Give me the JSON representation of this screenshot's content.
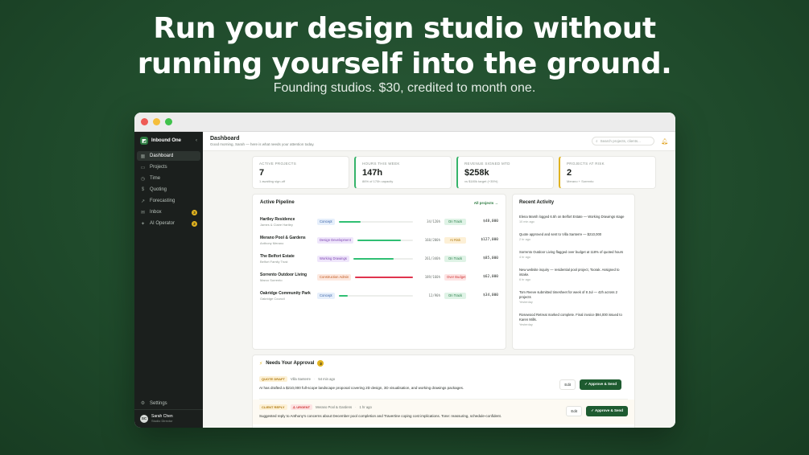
{
  "hero": {
    "line1": "Run your design studio without",
    "line2": "running yourself into the ground.",
    "sub": "Founding studios. $30, credited to month one."
  },
  "sidebar": {
    "brand": "Inbound One",
    "items": [
      {
        "label": "Dashboard",
        "icon": "grid-icon"
      },
      {
        "label": "Projects",
        "icon": "folder-icon"
      },
      {
        "label": "Time",
        "icon": "clock-icon"
      },
      {
        "label": "Quoting",
        "icon": "dollar-icon"
      },
      {
        "label": "Forecasting",
        "icon": "trend-icon"
      },
      {
        "label": "Inbox",
        "icon": "inbox-icon",
        "badge": "3"
      },
      {
        "label": "AI Operator",
        "icon": "sparkle-icon",
        "badge": "2"
      }
    ],
    "settings": "Settings",
    "user": {
      "initials": "SC",
      "name": "Sarah Chen",
      "role": "Studio Director"
    }
  },
  "topbar": {
    "title": "Dashboard",
    "subtitle": "Good morning, Sarah — here is what needs your attention today.",
    "search_placeholder": "Search projects, clients..."
  },
  "stats": [
    {
      "label": "ACTIVE PROJECTS",
      "value": "7",
      "note": "1 awaiting sign-off"
    },
    {
      "label": "HOURS THIS WEEK",
      "value": "147h",
      "note": "86% of 170h capacity"
    },
    {
      "label": "REVENUE SIGNED MTD",
      "value": "$258k",
      "note": "vs $180k target (+35%)"
    },
    {
      "label": "PROJECTS AT RISK",
      "value": "2",
      "note": "Merano + Sorrento"
    }
  ],
  "pipeline": {
    "title": "Active Pipeline",
    "link": "All projects →",
    "rows": [
      {
        "name": "Hartley Residence",
        "client": "James & Claire Hartley",
        "stage": "Concept",
        "progress": 0.3,
        "hours": "34/120h",
        "status": "On Track",
        "value": "$48,000"
      },
      {
        "name": "Merano Pool & Gardens",
        "client": "Anthony Merano",
        "stage": "Design Development",
        "progress": 0.78,
        "hours": "168/200h",
        "status": "At Risk",
        "value": "$127,000"
      },
      {
        "name": "The Belfort Estate",
        "client": "Belfort Family Trust",
        "stage": "Working Drawings",
        "progress": 0.68,
        "hours": "261/340h",
        "status": "On Track",
        "value": "$85,000"
      },
      {
        "name": "Sorrento Outdoor Living",
        "client": "Marco Sorrento",
        "stage": "Construction Admin",
        "progress": 1.0,
        "hours": "189/160h",
        "status": "Over Budget",
        "value": "$62,000"
      },
      {
        "name": "Oakridge Community Park",
        "client": "Oakridge Council",
        "stage": "Concept",
        "progress": 0.12,
        "hours": "12/90h",
        "status": "On Track",
        "value": "$34,000"
      }
    ]
  },
  "activity": {
    "title": "Recent Activity",
    "items": [
      {
        "text": "Elena Marsh logged 6.5h on Belfort Estate — Working Drawings stage",
        "when": "10 min ago"
      },
      {
        "text": "Quote approved and sent to Villa Santerre — $210,000",
        "when": "2 hr ago"
      },
      {
        "text": "Sorrento Outdoor Living flagged over budget at 118% of quoted hours",
        "when": "4 hr ago"
      },
      {
        "text": "New website inquiry — residential pool project, Toorak. Assigned to intake.",
        "when": "6 hr ago"
      },
      {
        "text": "Tom Reeve submitted timesheet for week of 8 Jul — 42h across 2 projects",
        "when": "Yesterday"
      },
      {
        "text": "Rosewood Retreat marked complete. Final invoice $94,000 issued to Karen Mills.",
        "when": "Yesterday"
      }
    ]
  },
  "approval": {
    "title": "Needs Your Approval",
    "count": "3",
    "rows": [
      {
        "tag": "QUOTE DRAFT",
        "urgent": "",
        "client": "Villa Santerre",
        "when": "54 min ago",
        "desc": "AI has drafted a $210,000 full-scope landscape proposal covering 2D design, 3D visualisation, and working drawings packages.",
        "edit": "Edit",
        "send": "✓ Approve & Send"
      },
      {
        "tag": "CLIENT REPLY",
        "urgent": "URGENT",
        "client": "Merano Pool & Gardens",
        "when": "1 hr ago",
        "desc": "Suggested reply to Anthony's concerns about December pool completion and Travertine coping cost implications. Tone: reassuring, schedule-confident.",
        "edit": "Edit",
        "send": "✓ Approve & Send"
      }
    ]
  },
  "colors": {
    "accent": "#2b7a3f",
    "warn": "#e0b21f",
    "danger": "#e0344e",
    "progress_green": "#2fbf73"
  }
}
